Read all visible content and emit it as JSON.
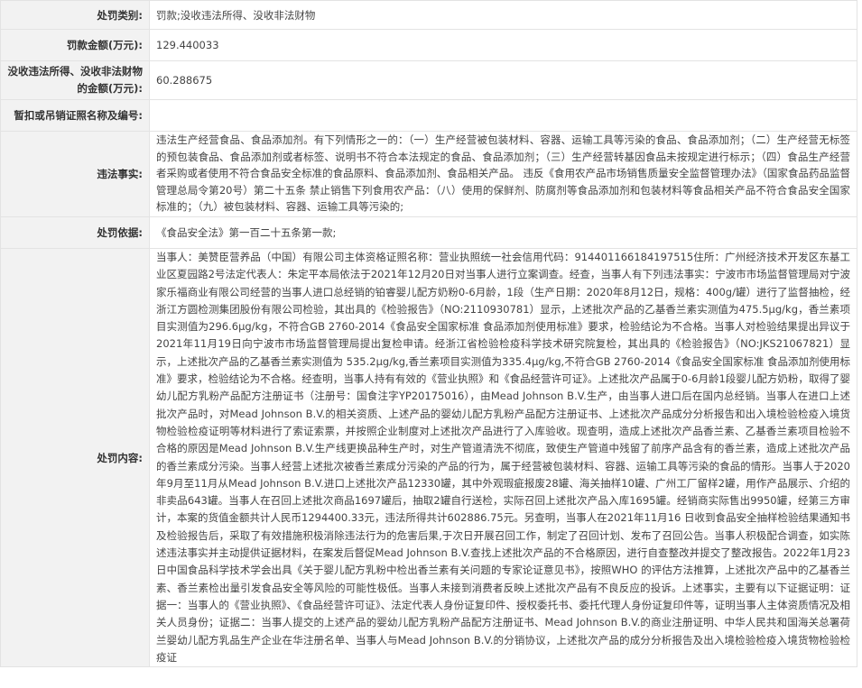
{
  "rows": {
    "category": {
      "label": "处罚类别:",
      "value": "罚款;没收违法所得、没收非法财物"
    },
    "fine": {
      "label": "罚款金额(万元):",
      "value": "129.440033"
    },
    "confiscation": {
      "label": "没收违法所得、没收非法财物的金额(万元):",
      "value": "60.288675"
    },
    "license": {
      "label": "暂扣或吊销证照名称及编号:",
      "value": ""
    },
    "facts": {
      "label": "违法事实:",
      "value": "违法生产经营食品、食品添加剂。有下列情形之一的：（一）生产经营被包装材料、容器、运输工具等污染的食品、食品添加剂；（二）生产经营无标签的预包装食品、食品添加剂或者标签、说明书不符合本法规定的食品、食品添加剂；（三）生产经营转基因食品未按规定进行标示；（四）食品生产经营者采购或者使用不符合食品安全标准的食品原料、食品添加剂、食品相关产品。 违反《食用农产品市场销售质量安全监督管理办法》（国家食品药品监督管理总局令第20号）第二十五条 禁止销售下列食用农产品：（八）使用的保鲜剂、防腐剂等食品添加剂和包装材料等食品相关产品不符合食品安全国家标准的；（九）被包装材料、容器、运输工具等污染的;"
    },
    "basis": {
      "label": "处罚依据:",
      "value": "《食品安全法》第一百二十五条第一款;"
    },
    "content": {
      "label": "处罚内容:",
      "value": "当事人：美赞臣营养品（中国）有限公司主体资格证照名称：营业执照统一社会信用代码：914401166184197515住所：广州经济技术开发区东基工业区夏园路2号法定代表人：朱定平本局依法于2021年12月20日对当事人进行立案调查。经查，当事人有下列违法事实：宁波市市场监督管理局对宁波家乐福商业有限公司经营的当事人进口总经销的铂睿婴儿配方奶粉0-6月龄，1段（生产日期：2020年8月12日，规格：400g/罐）进行了监督抽检，经浙江方圆检测集团股份有限公司检验，其出具的《检验报告》（NO:2110930781）显示，上述批次产品的乙基香兰素实测值为475.5μg/kg，香兰素项目实测值为296.6μg/kg，不符合GB 2760-2014《食品安全国家标准 食品添加剂使用标准》要求，检验结论为不合格。当事人对检验结果提出异议于2021年11月19日向宁波市市场监督管理局提出复检申请。经浙江省检验检疫科学技术研究院复检，其出具的《检验报告》（NO:JKS21067821）显示，上述批次产品的乙基香兰素实测值为 535.2μg/kg,香兰素项目实测值为335.4μg/kg,不符合GB 2760-2014《食品安全国家标准 食品添加剂使用标准》要求，检验结论为不合格。经查明，当事人持有有效的《营业执照》和《食品经营许可证》。上述批次产品属于0-6月龄1段婴儿配方奶粉，取得了婴幼儿配方乳粉产品配方注册证书（注册号：国食注字YP20175016），由Mead Johnson B.V.生产，由当事人进口后在国内总经销。当事人在进口上述批次产品时，对Mead Johnson B.V.的相关资质、上述产品的婴幼儿配方乳粉产品配方注册证书、上述批次产品成分分析报告和出入境检验检疫入境货物检验检疫证明等材料进行了索证索票，并按照企业制度对上述批次产品进行了入库验收。现查明，造成上述批次产品香兰素、乙基香兰素项目检验不合格的原因是Mead Johnson B.V.生产线更换品种生产时，对生产管道清洗不彻底，致使生产管道中残留了前序产品含有的香兰素，造成上述批次产品的香兰素成分污染。当事人经营上述批次被香兰素成分污染的产品的行为，属于经营被包装材料、容器、运输工具等污染的食品的情形。当事人于2020年9月至11月从Mead Johnson B.V.进口上述批次产品12330罐，其中外观瑕疵报废28罐、海关抽样10罐、广州工厂留样2罐，用作产品展示、介绍的非卖品643罐。当事人在召回上述批次商品1697罐后，抽取2罐自行送检，实际召回上述批次产品入库1695罐。经销商实际售出9950罐，经第三方审计，本案的货值金额共计人民币1294400.33元，违法所得共计602886.75元。另查明，当事人在2021年11月16 日收到食品安全抽样检验结果通知书及检验报告后，采取了有效措施积极消除违法行为的危害后果,于次日开展召回工作，制定了召回计划、发布了召回公告。当事人积极配合调查，如实陈述违法事实并主动提供证据材料，在案发后督促Mead Johnson B.V.查找上述批次产品的不合格原因，进行自查整改并提交了整改报告。2022年1月23日中国食品科学技术学会出具《关于婴儿配方乳粉中检出香兰素有关问题的专家论证意见书》，按照WHO 的评估方法推算，上述批次产品中的乙基香兰素、香兰素检出量引发食品安全等风险的可能性极低。当事人未接到消费者反映上述批次产品有不良反应的投诉。上述事实，主要有以下证据证明：证据一：当事人的《营业执照》、《食品经营许可证》、法定代表人身份证复印件、授权委托书、委托代理人身份证复印件等，证明当事人主体资质情况及相关人员身份；证据二：当事人提交的上述产品的婴幼儿配方乳粉产品配方注册证书、Mead Johnson B.V.的商业注册证明、中华人民共和国海关总署荷兰婴幼儿配方乳品生产企业在华注册名单、当事人与Mead Johnson B.V.的分销协议，上述批次产品的成分分析报告及出入境检验检疫入境货物检验检疫证"
    }
  }
}
